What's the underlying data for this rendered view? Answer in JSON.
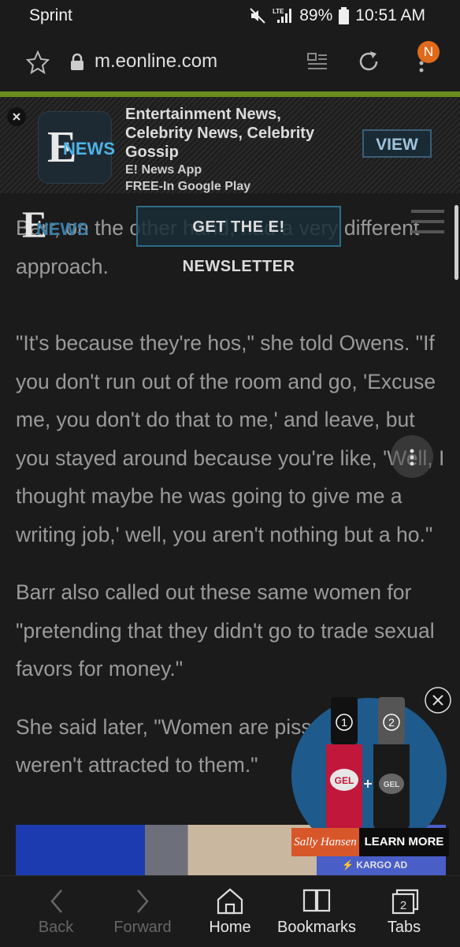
{
  "status_bar": {
    "carrier": "Sprint",
    "battery": "89%",
    "time": "10:51 AM",
    "network": "LTE"
  },
  "browser": {
    "url": "m.eonline.com",
    "account_initial": "N"
  },
  "ad_banner": {
    "title": "Entertainment News, Celebrity News, Celebrity Gossip",
    "subtitle1": "E! News App",
    "subtitle2": "FREE-In Google Play",
    "cta": "VIEW",
    "logo_e": "E",
    "logo_news": "NEWS"
  },
  "site_header": {
    "logo_e": "E",
    "logo_news": "NEWS",
    "newsletter_button": "GET THE E! NEWSLETTER"
  },
  "article": {
    "paragraphs": [
      "Barr, on the other hand, had a very different approach.",
      "\"It's because they're hos,\" she told Owens. \"If you don't run out of the room and go, 'Excuse me, you don't do that to me,' and leave, but you stayed around because you're like, 'Well, I thought maybe he was going to give me a writing job,' well, you aren't nothing but a ho.\"",
      "Barr also called out these same women for \"pretending that they didn't go to trade sexual favors for money.\"",
      "She said later, \"Women are pissed they weren't attracted to them.\""
    ]
  },
  "video_ad": {
    "brand": "Sally Hansen",
    "cta": "LEARN MORE",
    "network": "KARGO AD",
    "step1": "1",
    "step2": "2",
    "gel": "GEL"
  },
  "bottom_nav": {
    "back": "Back",
    "forward": "Forward",
    "home": "Home",
    "bookmarks": "Bookmarks",
    "tabs": "Tabs",
    "tab_count": "2"
  },
  "colors": {
    "accent_green": "#6a8d1d",
    "brand_orange": "#d8572a",
    "background": "#1b1b1b"
  }
}
